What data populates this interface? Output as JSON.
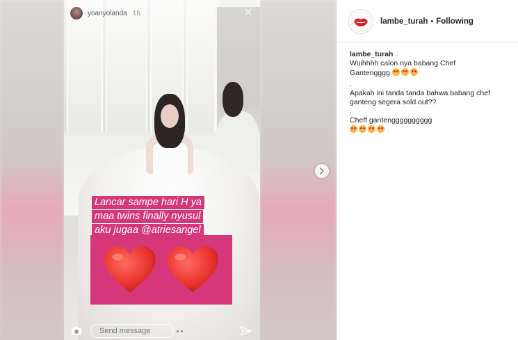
{
  "story": {
    "username": "yoanyolanda",
    "time": "1h",
    "text_lines": [
      "Lancar sampe hari H ya",
      "maa twins  finally nyusul",
      "aku jugaa @atriesangel"
    ],
    "reply_placeholder": "Send message",
    "close_icon": "close-icon",
    "camera_icon": "camera-icon",
    "send_icon": "send-icon",
    "heart_color": "#e8312c",
    "text_bg_color": "#d4387a"
  },
  "post": {
    "username": "lambe_turah",
    "follow_status": "Following",
    "caption": {
      "author": "lambe_turah",
      "after_author": " .",
      "lines": [
        "Wuihhhh calon nya babang Chef",
        "Gantengggg",
        ".",
        "Apakah ini tanda tanda bahwa babang chef",
        "ganteng segera sold out??",
        ".",
        "Cheff gantengggggggggg"
      ]
    }
  }
}
